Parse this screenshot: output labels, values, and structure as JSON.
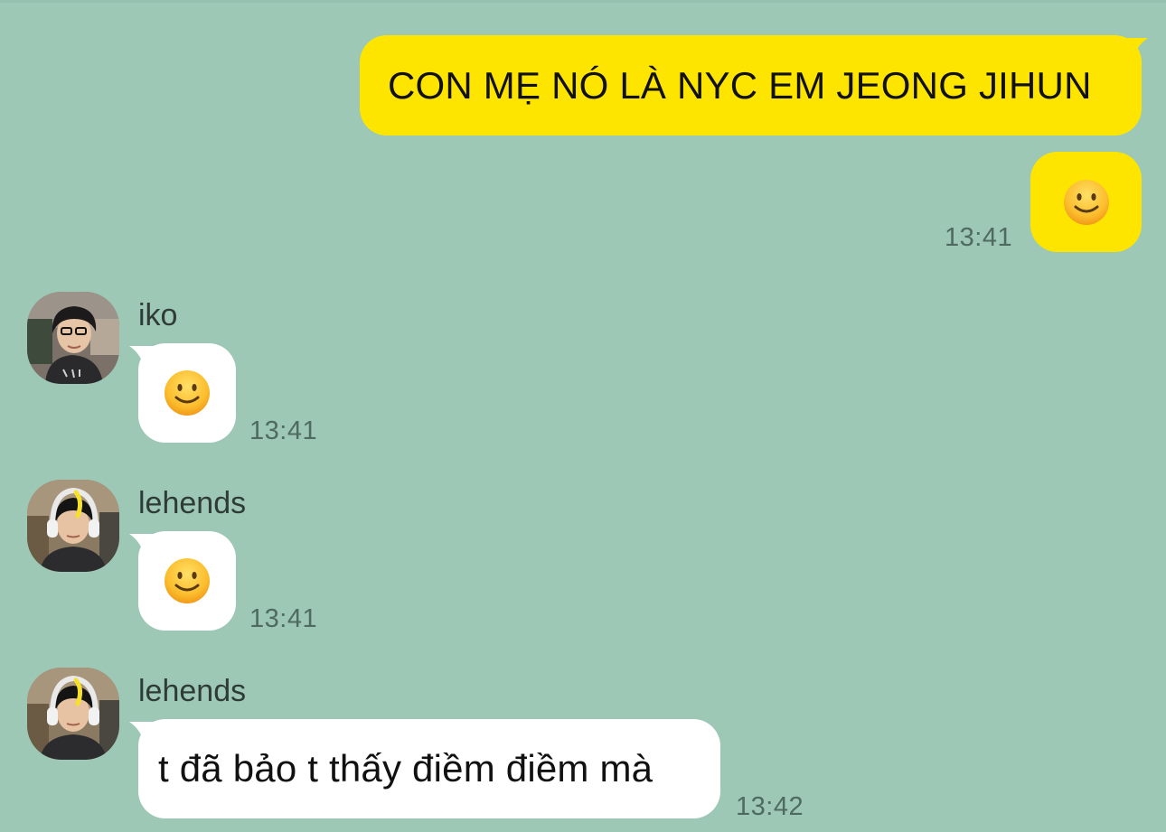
{
  "colors": {
    "background": "#9dc8b6",
    "my_bubble": "#fee500",
    "their_bubble": "#ffffff",
    "timestamp": "#4f6a60"
  },
  "messages": {
    "m1": {
      "direction": "outgoing",
      "text": "CON MẸ NÓ LÀ NYC EM JEONG JIHUN"
    },
    "m2": {
      "direction": "outgoing",
      "emoji": "slightly-smiling-face-icon",
      "time": "13:41"
    },
    "m3": {
      "direction": "incoming",
      "sender": "iko",
      "emoji": "slightly-smiling-face-icon",
      "time": "13:41"
    },
    "m4": {
      "direction": "incoming",
      "sender": "lehends",
      "emoji": "slightly-smiling-face-icon",
      "time": "13:41"
    },
    "m5": {
      "direction": "incoming",
      "sender": "lehends",
      "text": "t đã bảo t thấy điềm điềm mà",
      "time": "13:42"
    }
  }
}
